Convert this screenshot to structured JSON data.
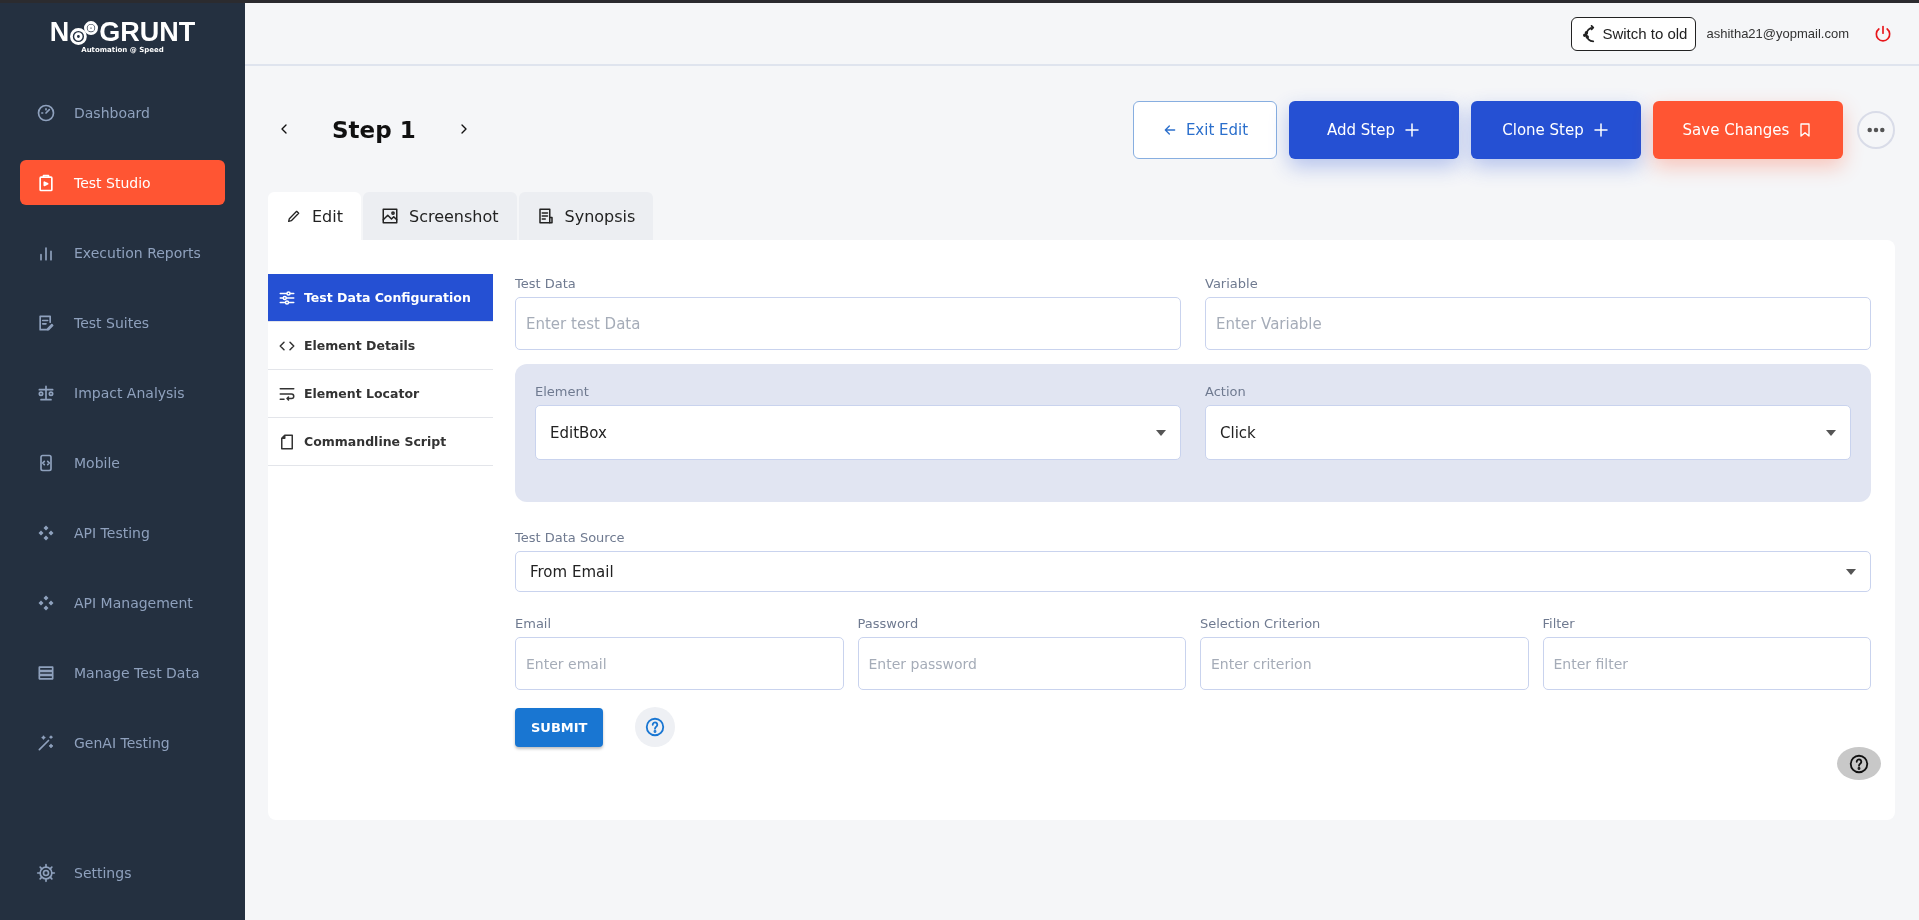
{
  "sidebar": {
    "logo": {
      "title_start": "N",
      "title_end": "GRUNT",
      "tagline": "Automation @ Speed"
    },
    "items": [
      {
        "label": "Dashboard",
        "kind": "gauge",
        "selected": false
      },
      {
        "label": "Test Studio",
        "kind": "clipboard",
        "selected": true
      },
      {
        "label": "Execution Reports",
        "kind": "bars",
        "selected": false
      },
      {
        "label": "Test Suites",
        "kind": "edit",
        "selected": false
      },
      {
        "label": "Impact Analysis",
        "kind": "scale",
        "selected": false
      },
      {
        "label": "Mobile",
        "kind": "phone",
        "selected": false
      },
      {
        "label": "API Testing",
        "kind": "diamond",
        "selected": false
      },
      {
        "label": "API Management",
        "kind": "diamond",
        "selected": false
      },
      {
        "label": "Manage Test Data",
        "kind": "server",
        "selected": false
      },
      {
        "label": "GenAI Testing",
        "kind": "wand",
        "selected": false
      }
    ],
    "bottom_item": {
      "label": "Settings",
      "kind": "gear",
      "selected": false
    }
  },
  "header": {
    "switch_button": "Switch to old",
    "user_email": "ashitha21@yopmail.com"
  },
  "step_bar": {
    "title": "Step 1",
    "buttons": [
      {
        "label": "Exit Edit",
        "kind": "outline"
      },
      {
        "label": "Add Step",
        "kind": "primary"
      },
      {
        "label": "Clone Step",
        "kind": "primary"
      },
      {
        "label": "Save Changes",
        "kind": "danger"
      }
    ]
  },
  "tabs": [
    {
      "label": "Edit",
      "kind": "pencil",
      "selected": true
    },
    {
      "label": "Screenshot",
      "kind": "image",
      "selected": false
    },
    {
      "label": "Synopsis",
      "kind": "doc",
      "selected": false
    }
  ],
  "side_menu": [
    {
      "label": "Test Data Configuration",
      "kind": "sliders",
      "selected": true
    },
    {
      "label": "Element Details",
      "kind": "code",
      "selected": false
    },
    {
      "label": "Element Locator",
      "kind": "wrap",
      "selected": false
    },
    {
      "label": "Commandline Script",
      "kind": "file",
      "selected": false
    }
  ],
  "form": {
    "top_fields": [
      {
        "label": "Test Data",
        "placeholder": "Enter test Data"
      },
      {
        "label": "Variable",
        "placeholder": "Enter Variable"
      }
    ],
    "panel_selects": [
      {
        "label": "Element",
        "value": "EditBox"
      },
      {
        "label": "Action",
        "value": "Click"
      }
    ],
    "source": {
      "label": "Test Data Source",
      "value": "From Email"
    },
    "email_fields": [
      {
        "label": "Email",
        "placeholder": "Enter email"
      },
      {
        "label": "Password",
        "placeholder": "Enter password"
      },
      {
        "label": "Selection Criterion",
        "placeholder": "Enter criterion"
      },
      {
        "label": "Filter",
        "placeholder": "Enter filter"
      }
    ],
    "submit": "SUBMIT"
  }
}
